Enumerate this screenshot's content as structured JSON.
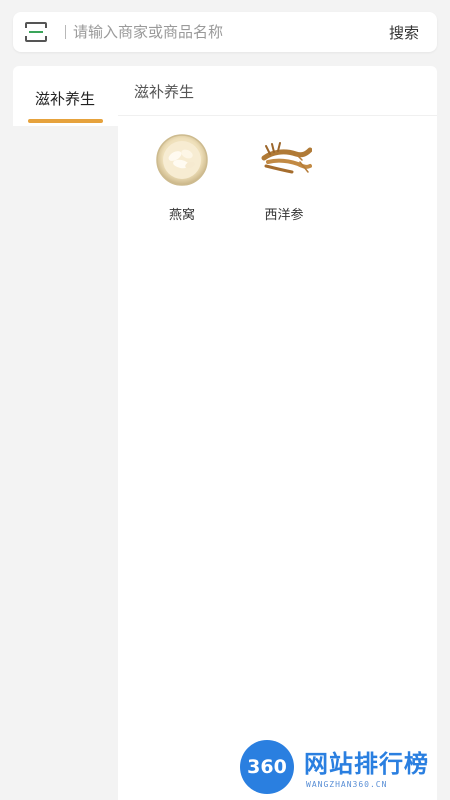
{
  "search": {
    "placeholder": "请输入商家或商品名称",
    "button_label": "搜索"
  },
  "sidebar": {
    "items": [
      {
        "label": "滋补养生",
        "selected": true
      }
    ],
    "indicator_color": "#e6a23c"
  },
  "content": {
    "section_title": "滋补养生",
    "products": [
      {
        "name": "燕窝",
        "icon": "birds-nest-icon"
      },
      {
        "name": "西洋参",
        "icon": "ginseng-icon"
      }
    ]
  },
  "watermark": {
    "badge": "360",
    "title": "网站排行榜",
    "subtitle": "WANGZHAN360.CN",
    "color": "#2a7fe0"
  }
}
